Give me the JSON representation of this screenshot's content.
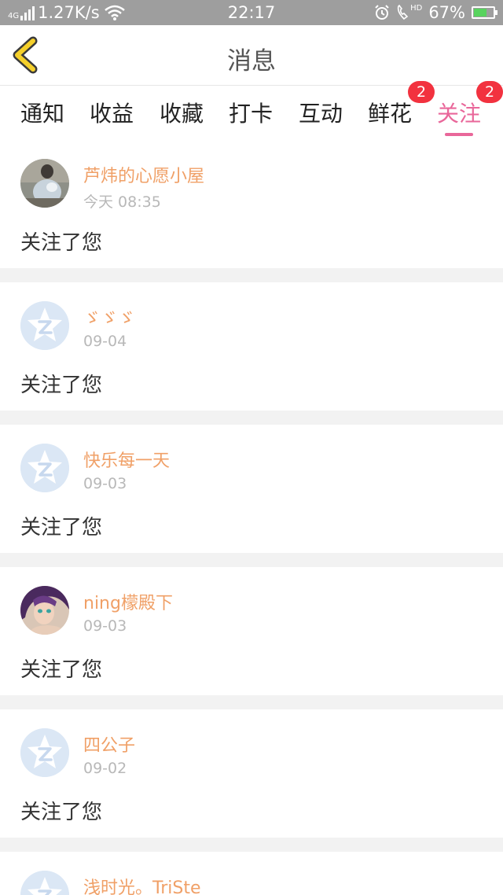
{
  "status_bar": {
    "network_type": "4G",
    "speed": "1.27K/s",
    "time": "22:17",
    "hd": "HD",
    "battery_percent": "67%",
    "battery_level": 0.67,
    "icons": [
      "signal-icon",
      "wifi-icon",
      "alarm-icon",
      "call-hd-icon",
      "battery-icon"
    ]
  },
  "header": {
    "title": "消息",
    "back_icon": "chevron-left-icon",
    "back_color": "#f5d02b"
  },
  "tabs": [
    {
      "label": "通知"
    },
    {
      "label": "收益"
    },
    {
      "label": "收藏"
    },
    {
      "label": "打卡"
    },
    {
      "label": "互动"
    },
    {
      "label": "鲜花",
      "badge": "2"
    },
    {
      "label": "关注",
      "badge": "2",
      "active": true
    }
  ],
  "colors": {
    "accent": "#e9679a",
    "name": "#f0a067",
    "badge": "#f2323f"
  },
  "feed": [
    {
      "name": "芦炜的心愿小屋",
      "time": "今天 08:35",
      "message": "关注了您",
      "avatar": "photo"
    },
    {
      "name": "ゞゞゞ",
      "time": "09-04",
      "message": "关注了您",
      "avatar": "default"
    },
    {
      "name": "快乐每一天",
      "time": "09-03",
      "message": "关注了您",
      "avatar": "default"
    },
    {
      "name": "ning檬殿下",
      "time": "09-03",
      "message": "关注了您",
      "avatar": "photo"
    },
    {
      "name": "四公子",
      "time": "09-02",
      "message": "关注了您",
      "avatar": "default"
    },
    {
      "name": "浅时光。TriSte",
      "time": "",
      "message": "",
      "avatar": "default"
    }
  ]
}
